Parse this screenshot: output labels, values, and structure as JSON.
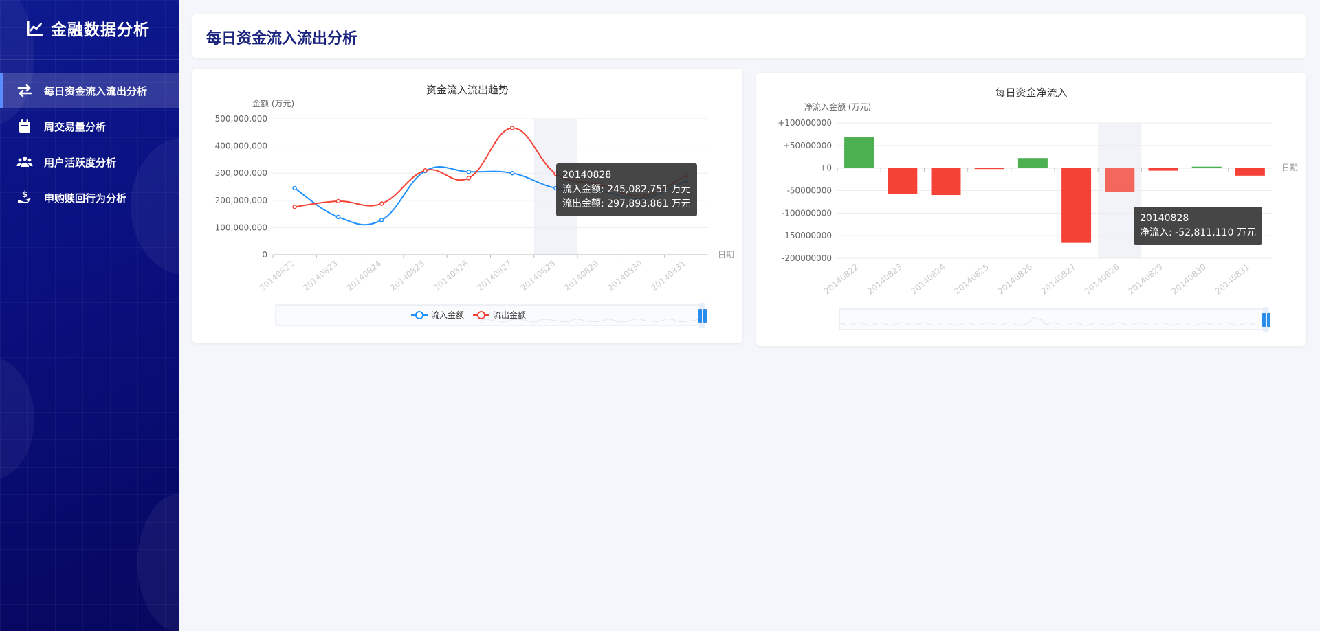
{
  "app": {
    "title": "金融数据分析",
    "logo_icon": "chart-line-icon"
  },
  "menu": [
    {
      "label": "每日资金流入流出分析",
      "icon": "exchange-arrows-icon",
      "active": true
    },
    {
      "label": "周交易量分析",
      "icon": "calendar-icon",
      "active": false
    },
    {
      "label": "用户活跃度分析",
      "icon": "users-icon",
      "active": false
    },
    {
      "label": "申购赎回行为分析",
      "icon": "hand-money-icon",
      "active": false
    }
  ],
  "page": {
    "title": "每日资金流入流出分析"
  },
  "colors": {
    "inflow": "#1e90ff",
    "outflow": "#f44336",
    "positive": "#4caf50",
    "negative": "#f44336",
    "sidebar": "#0a1080",
    "title": "#1a237e"
  },
  "chart1": {
    "title": "资金流入流出趋势",
    "ylabel": "金额 (万元)",
    "xlabel": "日期",
    "legend": [
      "流入金额",
      "流出金额"
    ],
    "tooltip": {
      "date": "20140828",
      "line1": "流入金额: 245,082,751 万元",
      "line2": "流出金额: 297,893,861 万元"
    }
  },
  "chart2": {
    "title": "每日资金净流入",
    "ylabel": "净流入金额 (万元)",
    "xlabel": "日期",
    "tooltip": {
      "date": "20140828",
      "line1": "净流入: -52,811,110 万元"
    }
  },
  "chart_data": [
    {
      "type": "line",
      "title": "资金流入流出趋势",
      "ylabel": "金额 (万元)",
      "xlabel": "日期",
      "ylim": [
        0,
        500000000
      ],
      "yticks": [
        0,
        100000000,
        200000000,
        300000000,
        400000000,
        500000000
      ],
      "ytick_labels": [
        "0",
        "100,000,000",
        "200,000,000",
        "300,000,000",
        "400,000,000",
        "500,000,000"
      ],
      "categories": [
        "20140822",
        "20140823",
        "20140824",
        "20140825",
        "20140826",
        "20140827",
        "20140828",
        "20140829",
        "20140830",
        "20140831"
      ],
      "series": [
        {
          "name": "流入金额",
          "values": [
            245000000,
            139000000,
            128000000,
            308000000,
            305000000,
            300000000,
            245082751,
            235000000,
            208000000,
            273000000
          ]
        },
        {
          "name": "流出金额",
          "values": [
            176000000,
            197000000,
            188000000,
            310000000,
            282000000,
            466000000,
            297893861,
            258000000,
            217000000,
            292000000
          ]
        }
      ],
      "highlight_category": "20140828",
      "legend_position": "bottom",
      "grid": true
    },
    {
      "type": "bar",
      "title": "每日资金净流入",
      "ylabel": "净流入金额 (万元)",
      "xlabel": "日期",
      "ylim": [
        -200000000,
        100000000
      ],
      "yticks": [
        -200000000,
        -150000000,
        -100000000,
        -50000000,
        0,
        50000000,
        100000000
      ],
      "ytick_labels": [
        "-200000000",
        "-150000000",
        "-100000000",
        "-50000000",
        "+0",
        "+50000000",
        "+100000000"
      ],
      "categories": [
        "20140822",
        "20140823",
        "20140824",
        "20140825",
        "20140826",
        "20140827",
        "20140828",
        "20140829",
        "20140830",
        "20140831"
      ],
      "values": [
        68000000,
        -58000000,
        -60000000,
        -2000000,
        22000000,
        -166000000,
        -52811110,
        -6000000,
        3000000,
        -17000000
      ],
      "highlight_category": "20140828",
      "grid": true
    }
  ]
}
